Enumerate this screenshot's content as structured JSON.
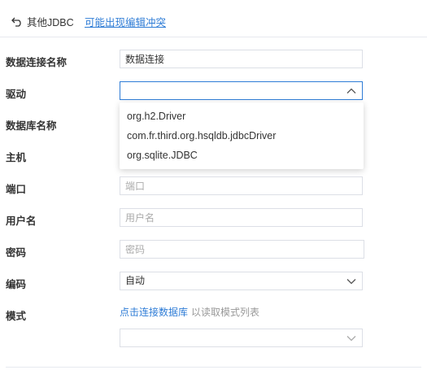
{
  "header": {
    "back_label": "其他JDBC",
    "conflict_link": "可能出现编辑冲突"
  },
  "form": {
    "connection_name": {
      "label": "数据连接名称",
      "value": "数据连接"
    },
    "driver": {
      "label": "驱动",
      "value": "",
      "options": [
        "org.h2.Driver",
        "com.fr.third.org.hsqldb.jdbcDriver",
        "org.sqlite.JDBC"
      ]
    },
    "database": {
      "label": "数据库名称"
    },
    "host": {
      "label": "主机"
    },
    "port": {
      "label": "端口",
      "placeholder": "端口"
    },
    "username": {
      "label": "用户名",
      "placeholder": "用户名"
    },
    "password": {
      "label": "密码",
      "placeholder": "密码"
    },
    "encoding": {
      "label": "编码",
      "value": "自动"
    },
    "schema": {
      "label": "模式",
      "link": "点击连接数据库",
      "hint": "以读取模式列表",
      "value": ""
    }
  },
  "colors": {
    "accent": "#2e7cd6",
    "border": "#dcdfe6",
    "placeholder": "#aaaaaa"
  },
  "icons": {
    "back": "back-arrow-icon",
    "chevron_up": "chevron-up-icon",
    "chevron_down": "chevron-down-icon"
  }
}
